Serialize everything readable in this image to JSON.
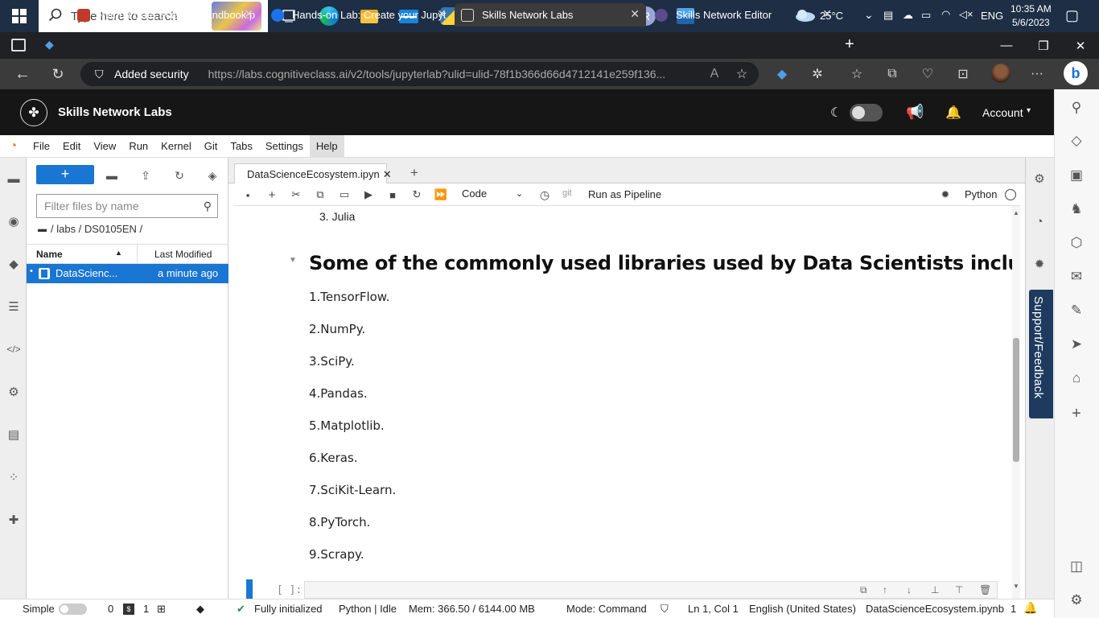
{
  "taskbar": {
    "search_placeholder": "Type here to search",
    "weather": "25°C",
    "language": "ENG",
    "time": "10:35 AM",
    "date": "5/6/2023",
    "app_icons": [
      "task-view",
      "edge",
      "file-explorer",
      "mail",
      "python",
      "chrome",
      "word",
      "excel",
      "opera",
      "r-app",
      "photos"
    ]
  },
  "browser": {
    "tabs": [
      {
        "label": "Python Data Science Handbook.p"
      },
      {
        "label": "Hands-on Lab: Create your Jupyt"
      },
      {
        "label": "Skills Network Labs"
      },
      {
        "label": "Skills Network Editor"
      }
    ],
    "security_label": "Added security",
    "url": "https://labs.cognitiveclass.ai/v2/tools/jupyterlab?ulid=ulid-78f1b366d66d4712141e259f136..."
  },
  "app": {
    "title": "Skills Network Labs",
    "account_label": "Account"
  },
  "menu": [
    "File",
    "Edit",
    "View",
    "Run",
    "Kernel",
    "Git",
    "Tabs",
    "Settings",
    "Help"
  ],
  "filebrowser": {
    "new_label": "+",
    "filter_placeholder": "Filter files by name",
    "breadcrumb": "/ labs / DS0105EN /",
    "col_name": "Name",
    "col_modified": "Last Modified",
    "file_name": "DataScienc...",
    "file_modified": "a minute ago"
  },
  "notebook": {
    "tab_label": "DataScienceEcosystem.ipyn",
    "cell_type": "Code",
    "git_label": "git",
    "pipeline_label": "Run as Pipeline",
    "kernel_label": "Python",
    "prev_item": "3. Julia",
    "heading": "Some of the commonly used libraries used by Data Scientists include:",
    "libraries": [
      "1.TensorFlow.",
      "2.NumPy.",
      "3.SciPy.",
      "4.Pandas.",
      "5.Matplotlib.",
      "6.Keras.",
      "7.SciKit-Learn.",
      "8.PyTorch.",
      "9.Scrapy."
    ],
    "next_prompt": "[ ]:"
  },
  "support_label": "Support/Feedback",
  "status": {
    "mode": "Simple",
    "terminals": "0",
    "kernels": "1",
    "init": "Fully initialized",
    "kernel": "Python | Idle",
    "mem": "Mem: 366.50 / 6144.00 MB",
    "cmd_mode": "Mode: Command",
    "cursor": "Ln 1, Col 1",
    "language": "English (United States)",
    "file": "DataScienceEcosystem.ipynb",
    "count": "1"
  },
  "colors": {
    "accent": "#1976d2",
    "header": "#161616",
    "taskbar": "#1d2e45"
  }
}
